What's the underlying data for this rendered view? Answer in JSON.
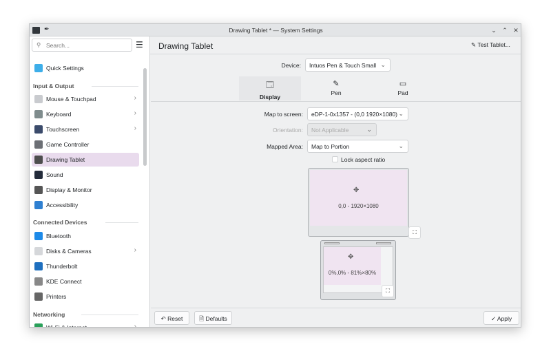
{
  "window": {
    "title": "Drawing Tablet * — System Settings",
    "controls": [
      "minimize",
      "maximize",
      "close"
    ]
  },
  "sidebar": {
    "search_placeholder": "Search...",
    "items": [
      {
        "label": "Quick Settings",
        "icon": "quick-settings-icon",
        "color": "#3daee9"
      },
      {
        "label": "Mouse & Touchpad",
        "icon": "mouse-icon",
        "chevron": true,
        "color": "#c9cbcf"
      },
      {
        "label": "Keyboard",
        "icon": "keyboard-icon",
        "chevron": true,
        "color": "#7f8c8d"
      },
      {
        "label": "Touchscreen",
        "icon": "touchscreen-icon",
        "chevron": true,
        "color": "#3b4b6b"
      },
      {
        "label": "Game Controller",
        "icon": "gamepad-icon",
        "color": "#6c6f75"
      },
      {
        "label": "Drawing Tablet",
        "icon": "tablet-icon",
        "selected": true,
        "color": "#4d4d4d"
      },
      {
        "label": "Sound",
        "icon": "sound-icon",
        "color": "#232b3a"
      },
      {
        "label": "Display & Monitor",
        "icon": "monitor-icon",
        "color": "#555"
      },
      {
        "label": "Accessibility",
        "icon": "accessibility-icon",
        "color": "#2f80d1"
      },
      {
        "label": "Bluetooth",
        "icon": "bluetooth-icon",
        "color": "#1d8ae8"
      },
      {
        "label": "Disks & Cameras",
        "icon": "disk-icon",
        "chevron": true,
        "color": "#d5d7da"
      },
      {
        "label": "Thunderbolt",
        "icon": "thunderbolt-icon",
        "color": "#1e6fbf"
      },
      {
        "label": "KDE Connect",
        "icon": "kde-connect-icon",
        "color": "#888"
      },
      {
        "label": "Printers",
        "icon": "printer-icon",
        "color": "#666"
      },
      {
        "label": "Wi-Fi & Internet",
        "icon": "wifi-icon",
        "chevron": true,
        "color": "#2aa05a"
      }
    ],
    "sections": [
      "Input & Output",
      "Connected Devices",
      "Networking"
    ]
  },
  "header": {
    "title": "Drawing Tablet",
    "test_button": "Test Tablet..."
  },
  "device": {
    "label": "Device:",
    "value": "Intuos Pen & Touch Small"
  },
  "tabs": [
    {
      "label": "Display",
      "active": true
    },
    {
      "label": "Pen"
    },
    {
      "label": "Pad"
    }
  ],
  "form": {
    "map_to_screen_label": "Map to screen:",
    "map_to_screen_value": "eDP-1-0x1357 - (0,0 1920×1080)",
    "orientation_label": "Orientation:",
    "orientation_value": "Not Applicable",
    "mapped_area_label": "Mapped Area:",
    "mapped_area_value": "Map to Portion",
    "lock_aspect_label": "Lock aspect ratio",
    "lock_aspect_checked": false
  },
  "preview": {
    "screen_text": "0,0 - 1920×1080",
    "tablet_text": "0%,0% - 81%×80%"
  },
  "footer": {
    "reset": "Reset",
    "defaults": "Defaults",
    "apply": "Apply"
  },
  "accent": "#e9dbed"
}
